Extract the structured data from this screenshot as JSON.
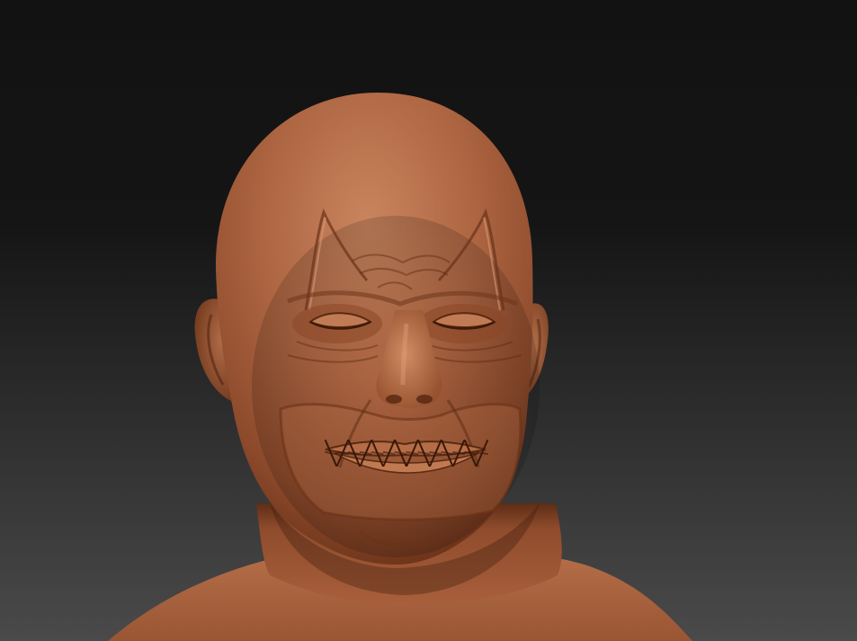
{
  "scene": {
    "subject": "sculpt-render",
    "colors": {
      "background_top": "#121212",
      "background_bottom": "#4a4a4a",
      "clay_light": "#c8805a",
      "clay_mid": "#a65e3b",
      "clay_dark": "#5a2c17",
      "clay_shadow": "#3a1a0c"
    }
  }
}
